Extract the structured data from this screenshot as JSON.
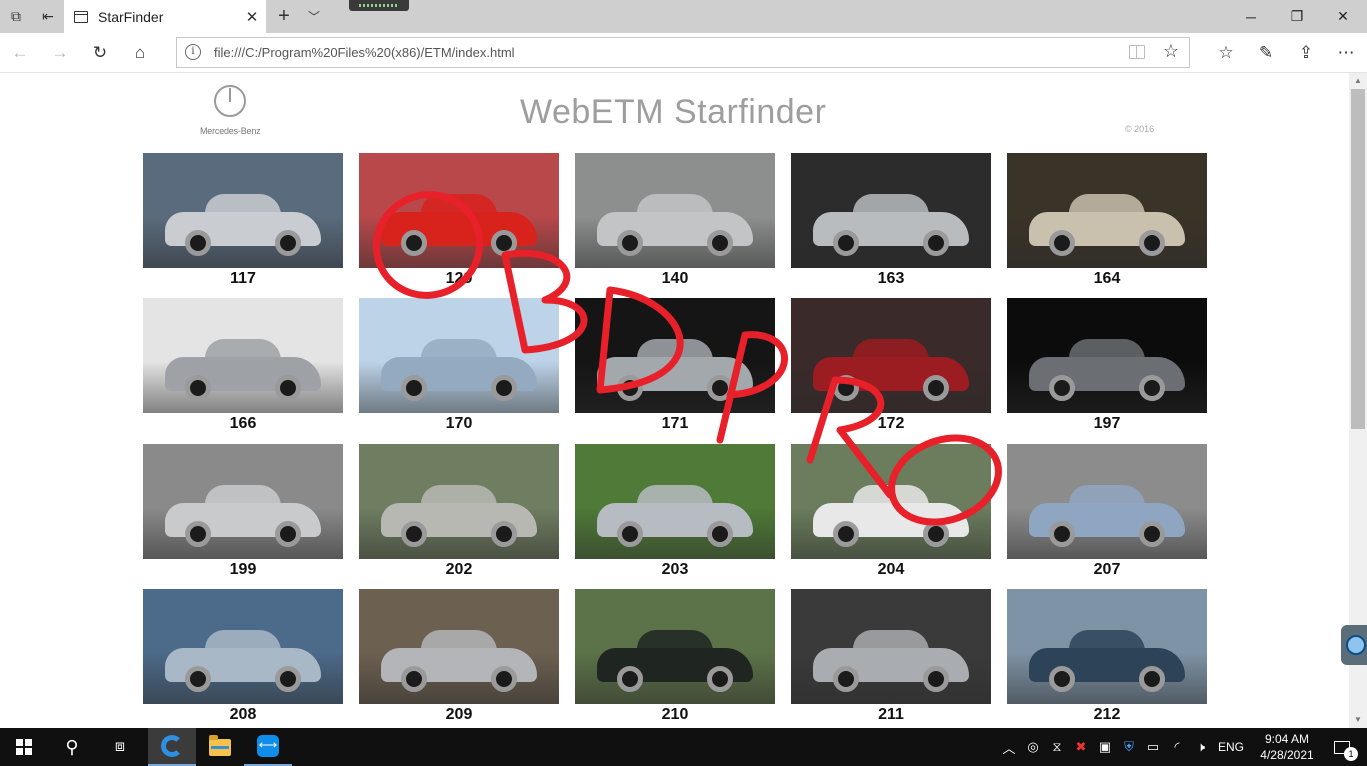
{
  "browser": {
    "tab_title": "StarFinder",
    "address_url": "file:///C:/Program%20Files%20(x86)/ETM/index.html"
  },
  "page": {
    "logo_text": "Mercedes-Benz",
    "site_title": "WebETM Starfinder",
    "copyright": "© 2016"
  },
  "models": [
    {
      "label": "117",
      "bg": "#5a6b7d",
      "car": "#c9ccd0"
    },
    {
      "label": "129",
      "bg": "#b8484a",
      "car": "#d8221c"
    },
    {
      "label": "140",
      "bg": "#8d8f8e",
      "car": "#c2c4c6"
    },
    {
      "label": "163",
      "bg": "#2c2c2c",
      "car": "#b9bcbf"
    },
    {
      "label": "164",
      "bg": "#3a3328",
      "car": "#c9c0ad"
    },
    {
      "label": "166",
      "bg": "#e4e4e4",
      "car": "#9ea2a6"
    },
    {
      "label": "170",
      "bg": "#bcd3e8",
      "car": "#94aac0"
    },
    {
      "label": "171",
      "bg": "#151515",
      "car": "#a3a8ad"
    },
    {
      "label": "172",
      "bg": "#3b2a2a",
      "car": "#9b1c21"
    },
    {
      "label": "197",
      "bg": "#0c0c0c",
      "car": "#6b6e72"
    },
    {
      "label": "199",
      "bg": "#8a8a8a",
      "car": "#c8cacc"
    },
    {
      "label": "202",
      "bg": "#6f7d60",
      "car": "#b8b8b3"
    },
    {
      "label": "203",
      "bg": "#4f7a37",
      "car": "#b7bcc2"
    },
    {
      "label": "204",
      "bg": "#6b7d5c",
      "car": "#e8e8e8"
    },
    {
      "label": "207",
      "bg": "#8c8c8c",
      "car": "#8fa6c2"
    },
    {
      "label": "208",
      "bg": "#4c6a8a",
      "car": "#a9b8c6"
    },
    {
      "label": "209",
      "bg": "#6c6050",
      "car": "#b3b5b8"
    },
    {
      "label": "210",
      "bg": "#5c7248",
      "car": "#1f2622"
    },
    {
      "label": "211",
      "bg": "#3a3a3a",
      "car": "#a9acb0"
    },
    {
      "label": "212",
      "bg": "#7f93a6",
      "car": "#2d4458"
    }
  ],
  "taskbar": {
    "language": "ENG",
    "time": "9:04 AM",
    "date": "4/28/2021",
    "notification_count": "1"
  },
  "colors": {
    "watermark": "#e8202a",
    "link_blue": "#2f8fe0"
  }
}
